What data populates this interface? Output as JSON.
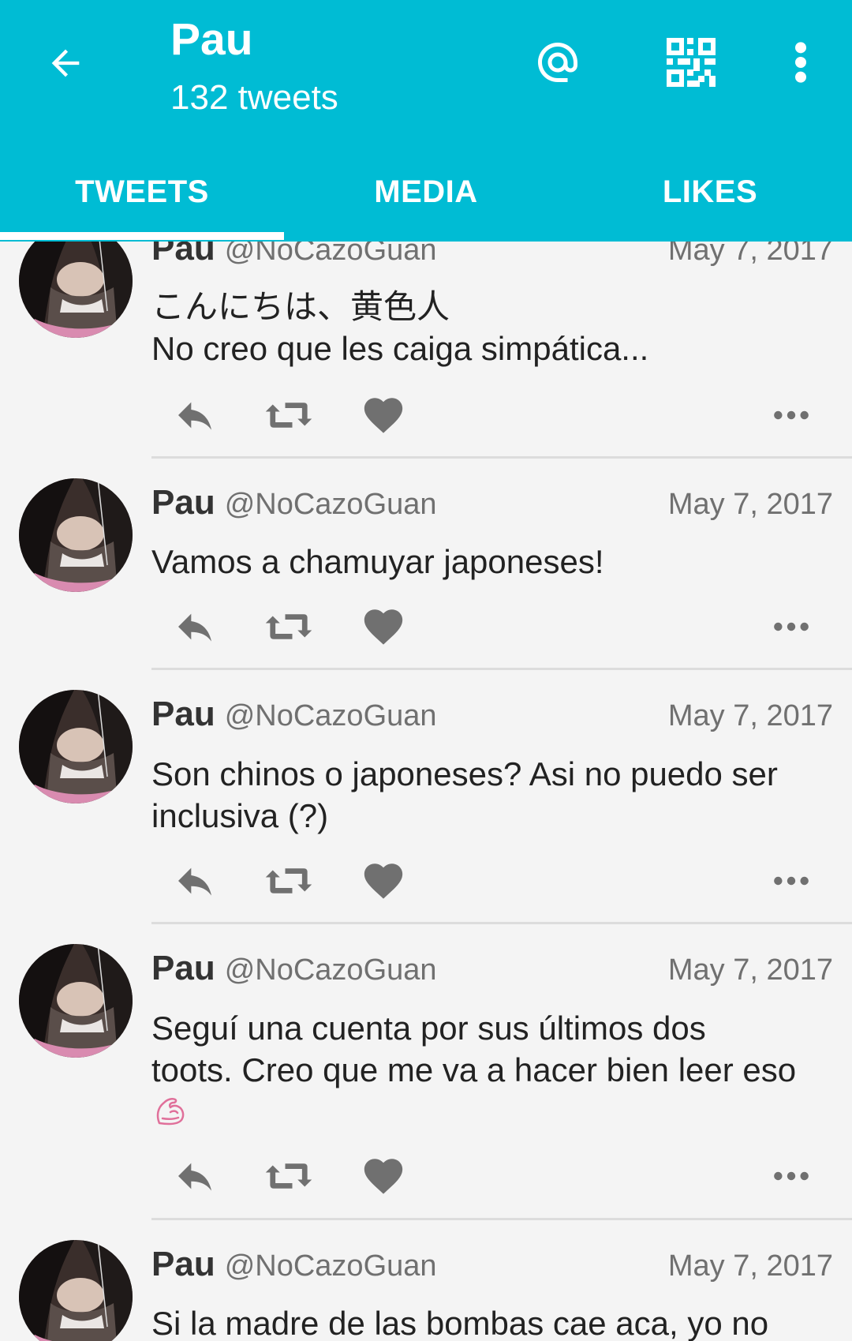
{
  "header": {
    "title": "Pau",
    "subtitle": "132 tweets",
    "icons": [
      "back-arrow-icon",
      "at-mention-icon",
      "qr-code-icon",
      "more-vertical-icon"
    ]
  },
  "tabs": [
    {
      "label": "TWEETS",
      "selected": true
    },
    {
      "label": "MEDIA",
      "selected": false
    },
    {
      "label": "LIKES",
      "selected": false
    }
  ],
  "colors": {
    "accent": "#00BCD4",
    "background": "#f4f4f4",
    "icon_gray": "#707070",
    "text": "#222222"
  },
  "tweets": [
    {
      "name": "Pau",
      "handle": "@NoCazoGuan",
      "date": "May 7, 2017",
      "line1": "こんにちは、黄色人",
      "line2": "No creo que les caiga simpática..."
    },
    {
      "name": "Pau",
      "handle": "@NoCazoGuan",
      "date": "May 7, 2017",
      "line1": "Vamos a chamuyar japoneses!"
    },
    {
      "name": "Pau",
      "handle": "@NoCazoGuan",
      "date": "May 7, 2017",
      "line1": "Son chinos o japoneses? Asi no puedo ser",
      "line2": "inclusiva (?)"
    },
    {
      "name": "Pau",
      "handle": "@NoCazoGuan",
      "date": "May 7, 2017",
      "line1": "Seguí una cuenta por sus últimos dos",
      "line2": "toots. Creo que me va a hacer bien leer eso",
      "emoji": "flexed-biceps-emoji"
    },
    {
      "name": "Pau",
      "handle": "@NoCazoGuan",
      "date": "May 7, 2017",
      "line1": "Si  la madre de las bombas cae aca, yo no"
    }
  ]
}
